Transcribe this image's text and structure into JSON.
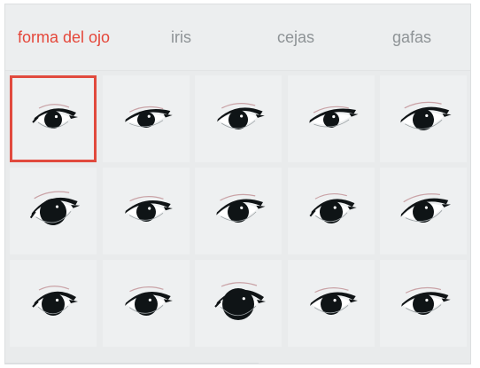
{
  "tabs": [
    {
      "label": "forma del ojo",
      "active": true
    },
    {
      "label": "iris",
      "active": false
    },
    {
      "label": "cejas",
      "active": false
    },
    {
      "label": "gafas",
      "active": false
    }
  ],
  "colors": {
    "accent": "#e5473a",
    "selection_border": "#e14a3e",
    "iris": "#0f1416",
    "lash": "#101416",
    "crease": "#c9a2a6",
    "tile_bg": "#eef0f1"
  },
  "selected_index": 0,
  "eye_options": [
    {
      "icon": "eye-shape-1"
    },
    {
      "icon": "eye-shape-2"
    },
    {
      "icon": "eye-shape-3"
    },
    {
      "icon": "eye-shape-4"
    },
    {
      "icon": "eye-shape-5"
    },
    {
      "icon": "eye-shape-6"
    },
    {
      "icon": "eye-shape-7"
    },
    {
      "icon": "eye-shape-8"
    },
    {
      "icon": "eye-shape-9"
    },
    {
      "icon": "eye-shape-10"
    },
    {
      "icon": "eye-shape-11"
    },
    {
      "icon": "eye-shape-12"
    },
    {
      "icon": "eye-shape-13"
    },
    {
      "icon": "eye-shape-14"
    },
    {
      "icon": "eye-shape-15"
    }
  ]
}
